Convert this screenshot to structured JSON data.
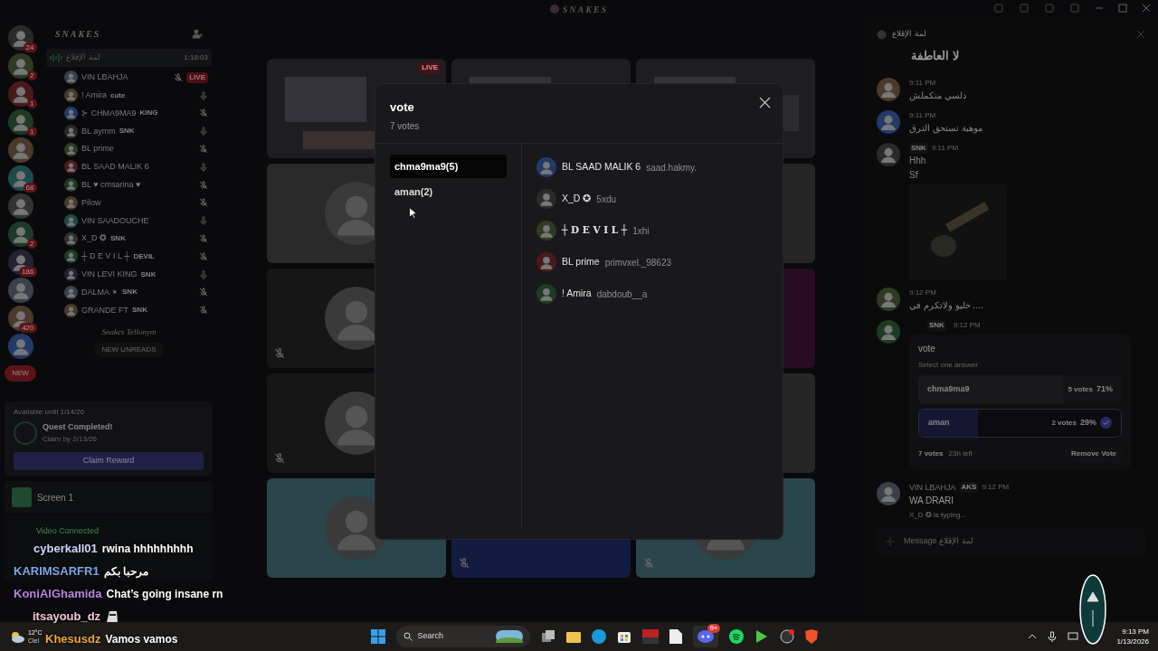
{
  "window": {
    "title": "SNAKES"
  },
  "servers": [
    {
      "kind": "badged",
      "badge": "24"
    },
    {
      "kind": "badged",
      "badge": "2"
    },
    {
      "kind": "badged",
      "badge": "1"
    },
    {
      "kind": "badged",
      "badge": "1"
    },
    {
      "kind": "plain"
    },
    {
      "kind": "badged",
      "badge": "68"
    },
    {
      "kind": "plain"
    },
    {
      "kind": "badged",
      "badge": "2"
    },
    {
      "kind": "badged",
      "badge": "186"
    },
    {
      "kind": "plain"
    },
    {
      "kind": "badged",
      "badge": "420"
    },
    {
      "kind": "plain"
    }
  ],
  "servers_new": "NEW",
  "sidebar": {
    "server_name": "SNAKES",
    "voice_channel": {
      "name": "لمة الإقلاع",
      "time": "1:18:03"
    },
    "members": [
      {
        "name": "VIN LBAHJA",
        "live": "LIVE",
        "muted": true
      },
      {
        "name": "! Amira",
        "tag": "cute",
        "muted": false
      },
      {
        "name": "⊱ CHMA9MA9",
        "tag": "KING",
        "muted": true
      },
      {
        "name": "BL aymm",
        "tag": "SNK",
        "muted": false
      },
      {
        "name": "BL prime",
        "muted": true
      },
      {
        "name": "BL SAAD MALIK 6",
        "muted": false
      },
      {
        "name": "BL ♥ cmsarina ♥",
        "muted": true
      },
      {
        "name": "Pilow",
        "muted": true
      },
      {
        "name": "VIN SAADOUCHE",
        "muted": false
      },
      {
        "name": "X_D ✪",
        "tag": "SNK",
        "muted": true
      },
      {
        "name": "┼ D E V I L ┼",
        "tag": "DEVIL",
        "muted": true
      },
      {
        "name": "VIN LEVI KING",
        "tag": "SNK",
        "muted": false
      },
      {
        "name": "DALMA ✶",
        "tag": "SNK",
        "muted": true
      },
      {
        "name": "GRANDE FT",
        "tag": "SNK",
        "muted": true
      }
    ],
    "category": "Snakes Tellonym",
    "new_unreads": "NEW UNREADS"
  },
  "quest": {
    "availability": "Available until 1/14/26",
    "title": "Quest Completed!",
    "subtitle": "Claim by 2/13/26",
    "button": "Claim Reward"
  },
  "screen_panel": {
    "title": "Screen 1"
  },
  "voice_panel": {
    "status": "Video Connected"
  },
  "stage": {
    "rows": [
      [
        {
          "kind": "video",
          "live": "LIVE"
        },
        {
          "kind": "video"
        },
        {
          "kind": "video"
        }
      ],
      [
        {
          "kind": "avatar",
          "muted": false
        },
        {
          "kind": "blank"
        }
      ],
      [
        {
          "kind": "avatar",
          "muted": true
        },
        {
          "kind": "blank"
        }
      ],
      [
        {
          "kind": "avatar",
          "muted": true
        },
        {
          "kind": "blank"
        }
      ],
      [
        {
          "kind": "avatar",
          "muted": false
        },
        {
          "kind": "blank",
          "muted": true
        },
        {
          "kind": "avatar",
          "muted": true
        }
      ]
    ]
  },
  "chat": {
    "channel": "لمة الإقلاع",
    "title": "لا العاطفة",
    "messages": [
      {
        "time": "9:11 PM",
        "lines": [
          "دلسي متكملش"
        ]
      },
      {
        "time": "9:11 PM",
        "lines": [
          "موهبة تستحق الترق"
        ]
      },
      {
        "time": "9:11 PM",
        "tag": "SNK",
        "lines": [
          "Hhh",
          "Sf"
        ],
        "image": true
      },
      {
        "time": "9:12 PM",
        "lines": [
          "خليو ولاتكرم في ...."
        ]
      }
    ],
    "poll_message": {
      "tag": "SNK",
      "time": "9:12 PM",
      "question": "vote",
      "hint": "Select one answer",
      "options": [
        {
          "label": "chma9ma9",
          "votes": "5 votes",
          "percent": "71%",
          "level": 0.71,
          "selected": false
        },
        {
          "label": "aman",
          "votes": "2 votes",
          "percent": "29%",
          "level": 0.29,
          "selected": true
        }
      ],
      "total": "7 votes",
      "time_left": "23h left",
      "button": "Remove Vote"
    },
    "last_message": {
      "author": "VIN LBAHJA",
      "tag": "AKS",
      "time": "9:12 PM",
      "text": "WA DRARI"
    },
    "typing": "X_D ✪ is typing...",
    "placeholder": "Message لمة الإقلاع"
  },
  "modal": {
    "title": "vote",
    "subtitle": "7 votes",
    "answers": [
      {
        "label": "chma9ma9(5)",
        "selected": true
      },
      {
        "label": "aman(2)",
        "selected": false
      }
    ],
    "voters": [
      {
        "name": "BL SAAD MALIK 6",
        "username": "saad.hakmy."
      },
      {
        "name": "X_D ✪",
        "username": "5xdu"
      },
      {
        "name": "┼ D E V I L ┼",
        "username": "1xhi"
      },
      {
        "name": "BL prime",
        "username": "primvxel._98623"
      },
      {
        "name": "! Amira",
        "username": "dabdoub__a"
      }
    ]
  },
  "overlay_chat": [
    {
      "user": "cyberkall01",
      "color": "#cdd8ff",
      "text": "rwina hhhhhhhhh"
    },
    {
      "user": "KARIMSARFR1",
      "color": "#7fa8e6",
      "text": "مرحبا بكم"
    },
    {
      "user": "KoniAlGhamida",
      "color": "#b784e0",
      "text": "Chat’s going insane rn"
    },
    {
      "user": "itsayoub_dz",
      "color": "#efc6d6"
    },
    {
      "user": "Khesusdz",
      "color": "#e9a83a",
      "text": "Vamos vamos"
    }
  ],
  "taskbar": {
    "temperature": "12°C",
    "weather": "Ciel",
    "search": "Search",
    "discord_badge": "9+",
    "time": "9:13 PM",
    "date": "1/13/2026"
  }
}
